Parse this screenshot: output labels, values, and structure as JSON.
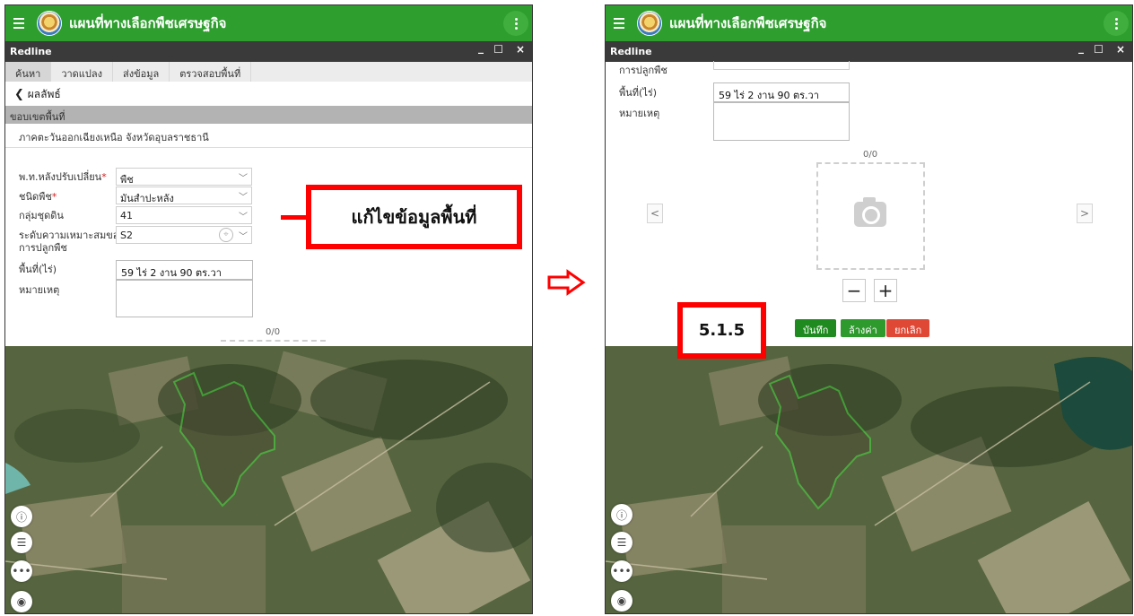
{
  "app": {
    "title": "แผนที่ทางเลือกพืชเศรษฐกิจ"
  },
  "panel": {
    "title": "Redline",
    "minimize": "_",
    "maximize": "☐",
    "close": "×"
  },
  "tabs": [
    "ค้นหา",
    "วาดแปลง",
    "ส่งข้อมูล",
    "ตรวจสอบพื้นที่"
  ],
  "back_label": "ผลลัพธ์",
  "section": {
    "title": "ขอบเขตพื้นที่",
    "region": "ภาคตะวันออกเฉียงเหนือ จังหวัดอุบลราชธานี"
  },
  "form": {
    "change_type_label": "พ.ท.หลังปรับเปลี่ยน",
    "change_type_value": "พืช",
    "crop_label": "ชนิดพืช",
    "crop_value": "มันสำปะหลัง",
    "soil_label": "กลุ่มชุดดิน",
    "soil_value": "41",
    "suit_label_1": "ระดับความเหมาะสมของ",
    "suit_label_2": "การปลูกพืช",
    "suit_value": "S2",
    "area_label": "พื้นที่(ไร่)",
    "area_value": "59 ไร่ 2 งาน 90 ตร.วา",
    "note_label": "หมายเหตุ",
    "required_mark": "*"
  },
  "photo": {
    "counter": "0/0"
  },
  "buttons": {
    "save": "บันทึก",
    "clear": "ล้างค่า",
    "cancel": "ยกเลิก"
  },
  "callouts": {
    "edit": "แก้ไขข้อมูลพื้นที่",
    "step": "5.1.5"
  },
  "icons": {
    "info": "info-icon",
    "list": "list-icon",
    "more": "more-icon",
    "locate": "locate-icon",
    "camera": "camera-icon"
  }
}
